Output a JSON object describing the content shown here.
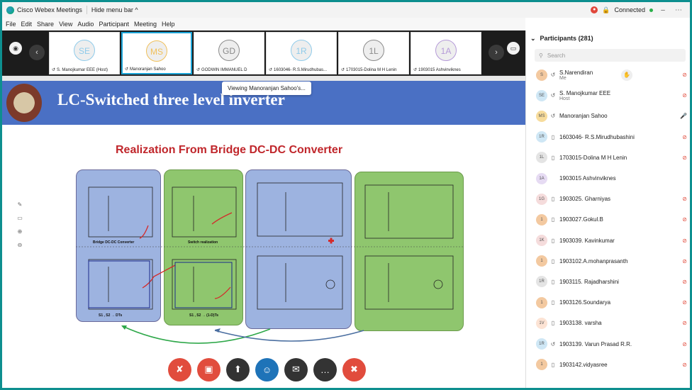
{
  "app": {
    "title": "Cisco Webex Meetings",
    "hide_menu_label": "Hide menu bar ^",
    "status": "Connected",
    "colors": {
      "accent": "#1e73b8",
      "end": "#e14c3d",
      "frame": "#0d8f8f"
    }
  },
  "menu": [
    "File",
    "Edit",
    "Share",
    "View",
    "Audio",
    "Participant",
    "Meeting",
    "Help"
  ],
  "video_strip": {
    "tiles": [
      {
        "initials": "SE",
        "name": "S. Manojkumar EEE (Host)",
        "color": "#8fcbea",
        "active": false
      },
      {
        "initials": "MS",
        "name": "Manoranjan Sahoo",
        "color": "#f0c05a",
        "active": true
      },
      {
        "initials": "GD",
        "name": "GODWIN IMMANUEL D",
        "color": "#8a8a8a",
        "active": false
      },
      {
        "initials": "1R",
        "name": "1603046- R.S.Mirudhubas...",
        "color": "#8fcbea",
        "active": false
      },
      {
        "initials": "1L",
        "name": "1703015-Dolina M H Lenin",
        "color": "#8a8a8a",
        "active": false
      },
      {
        "initials": "1A",
        "name": "1903015 Ashvinviknes",
        "color": "#b59ad8",
        "active": false
      }
    ]
  },
  "share": {
    "viewing_toast": "Viewing Manoranjan Sahoo's...",
    "slide_title": "LC-Switched three level inverter",
    "subtitle": "Realization From Bridge DC-DC Converter",
    "labels": [
      "Bridge DC-DC Converter",
      "Switch realization",
      "S1 , S2 → DTs",
      "S1 , S2 → (1-D)Ts"
    ]
  },
  "controls": [
    {
      "name": "mute-button",
      "icon": "✘",
      "style": "red"
    },
    {
      "name": "video-button",
      "icon": "▣",
      "style": "red"
    },
    {
      "name": "share-button",
      "icon": "⬆",
      "style": "dark"
    },
    {
      "name": "participants-button",
      "icon": "☺",
      "style": "blue"
    },
    {
      "name": "chat-button",
      "icon": "✉",
      "style": "dark"
    },
    {
      "name": "more-button",
      "icon": "…",
      "style": "dark"
    },
    {
      "name": "end-meeting-button",
      "icon": "✖",
      "style": "red"
    }
  ],
  "participants": {
    "title": "Participants (281)",
    "search_placeholder": "Search",
    "list": [
      {
        "initials": "S",
        "name": "S.Narendiran",
        "sub": "Me",
        "device": "↺",
        "color": "#f3c9a0",
        "mic": "red"
      },
      {
        "initials": "SE",
        "name": "S. Manojkumar EEE",
        "sub": "Host",
        "device": "↺",
        "color": "#cfe7f5",
        "mic": "red"
      },
      {
        "initials": "MS",
        "name": "Manoranjan Sahoo",
        "sub": "",
        "device": "↺",
        "color": "#f7dc9c",
        "mic": "blue"
      },
      {
        "initials": "1R",
        "name": "1603046- R.S.Mirudhubashini",
        "sub": "",
        "device": "▯",
        "color": "#cfe7f5",
        "mic": "red"
      },
      {
        "initials": "1L",
        "name": "1703015-Dolina M H Lenin",
        "sub": "",
        "device": "▯",
        "color": "#e4e4e4",
        "mic": "red"
      },
      {
        "initials": "1A",
        "name": "1903015 Ashvinviknes",
        "sub": "",
        "device": "",
        "color": "#e6dbf3",
        "mic": "none"
      },
      {
        "initials": "1G",
        "name": "1903025. Gharniyas",
        "sub": "",
        "device": "▯",
        "color": "#f5dcdc",
        "mic": "red"
      },
      {
        "initials": "1",
        "name": "1903027.Gokul.B",
        "sub": "",
        "device": "▯",
        "color": "#f3c9a0",
        "mic": "red"
      },
      {
        "initials": "1K",
        "name": "1903039. Kavinkumar",
        "sub": "",
        "device": "▯",
        "color": "#f5dcdc",
        "mic": "red"
      },
      {
        "initials": "1",
        "name": "1903102.A.mohanprasanth",
        "sub": "",
        "device": "▯",
        "color": "#f3c9a0",
        "mic": "red"
      },
      {
        "initials": "1R",
        "name": "1903115. Rajadharshini",
        "sub": "",
        "device": "▯",
        "color": "#e4e4e4",
        "mic": "red"
      },
      {
        "initials": "1",
        "name": "1903126.Soundarya",
        "sub": "",
        "device": "▯",
        "color": "#f3c9a0",
        "mic": "red"
      },
      {
        "initials": "1V",
        "name": "1903138. varsha",
        "sub": "",
        "device": "▯",
        "color": "#fce3d4",
        "mic": "red"
      },
      {
        "initials": "1R",
        "name": "1903139. Varun Prasad R.R.",
        "sub": "",
        "device": "↺",
        "color": "#cfe7f5",
        "mic": "red"
      },
      {
        "initials": "1",
        "name": "1903142.vidyasree",
        "sub": "",
        "device": "▯",
        "color": "#f3c9a0",
        "mic": "red"
      }
    ]
  }
}
